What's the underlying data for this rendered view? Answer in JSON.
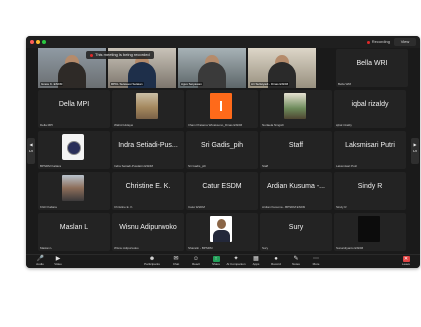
{
  "titlebar": {
    "recording_label": "Recording",
    "view_label": "View"
  },
  "banner": {
    "text": "This meeting is being recorded"
  },
  "strip": [
    {
      "name": "Grace K. ESDM"
    },
    {
      "name": "RPKL Sulawesi Selatan"
    },
    {
      "name": "Agus Setyawan"
    },
    {
      "name": "Ari Sulistyadi - Dinas ESDM"
    },
    {
      "name": "Della WRI"
    }
  ],
  "grid": [
    {
      "label": "Bella WRI",
      "sub": "Bella WRI"
    },
    {
      "label": "Della MPI",
      "sub": "Della MPI"
    },
    {
      "label": "",
      "sub": "Wahid Hidayat"
    },
    {
      "label": "",
      "sub": "Irham Pratama Wicaksono_Dinas ESDM"
    },
    {
      "label": "",
      "sub": "Nurlaela Ningsih"
    },
    {
      "label": "iqbal rizaldy",
      "sub": "iqbal rizaldy"
    },
    {
      "label": "",
      "sub": "BPSDM Kaltara"
    },
    {
      "label": "Indra Setiadi-Pus...",
      "sub": "Indra Setiadi-Pusdatin ESDM"
    },
    {
      "label": "Sri Gadis_pih",
      "sub": "Sri Gadis_pih"
    },
    {
      "label": "Staff",
      "sub": "Staff"
    },
    {
      "label": "Laksmisari Putri",
      "sub": "Laksmisari Putri"
    },
    {
      "label": "",
      "sub": "KGD Kaltara"
    },
    {
      "label": "Christine E. K.",
      "sub": "Christine E. K."
    },
    {
      "label": "Catur ESDM",
      "sub": "Catur ESDM"
    },
    {
      "label": "Ardian Kusuma -...",
      "sub": "Ardian Kusuma - BPSDM ESDM"
    },
    {
      "label": "Sindy R",
      "sub": "Sindy R"
    },
    {
      "label": "Maslan L",
      "sub": "Maslan L"
    },
    {
      "label": "Wisnu Adipurwoko",
      "sub": "Wisnu Adipurwoko"
    },
    {
      "label": "",
      "sub": "Sharatin - BPSDM"
    },
    {
      "label": "Sury",
      "sub": "Sury"
    },
    {
      "label": "",
      "sub": "Sunardiyanto ESDM"
    }
  ],
  "nav": {
    "left_page": "1/2",
    "right_page": "1/2"
  },
  "toolbar": [
    {
      "label": "Audio",
      "icon": "microphone-icon"
    },
    {
      "label": "Video",
      "icon": "video-camera-icon"
    },
    {
      "label": "Participants",
      "icon": "participants-icon"
    },
    {
      "label": "Chat",
      "icon": "chat-icon"
    },
    {
      "label": "React",
      "icon": "react-icon"
    },
    {
      "label": "Share",
      "icon": "share-screen-icon"
    },
    {
      "label": "AI Companion",
      "icon": "ai-companion-icon"
    },
    {
      "label": "Apps",
      "icon": "apps-icon"
    },
    {
      "label": "Record",
      "icon": "record-icon"
    },
    {
      "label": "Notes",
      "icon": "notes-icon"
    },
    {
      "label": "More",
      "icon": "more-icon"
    },
    {
      "label": "Leave",
      "icon": "leave-icon"
    }
  ]
}
